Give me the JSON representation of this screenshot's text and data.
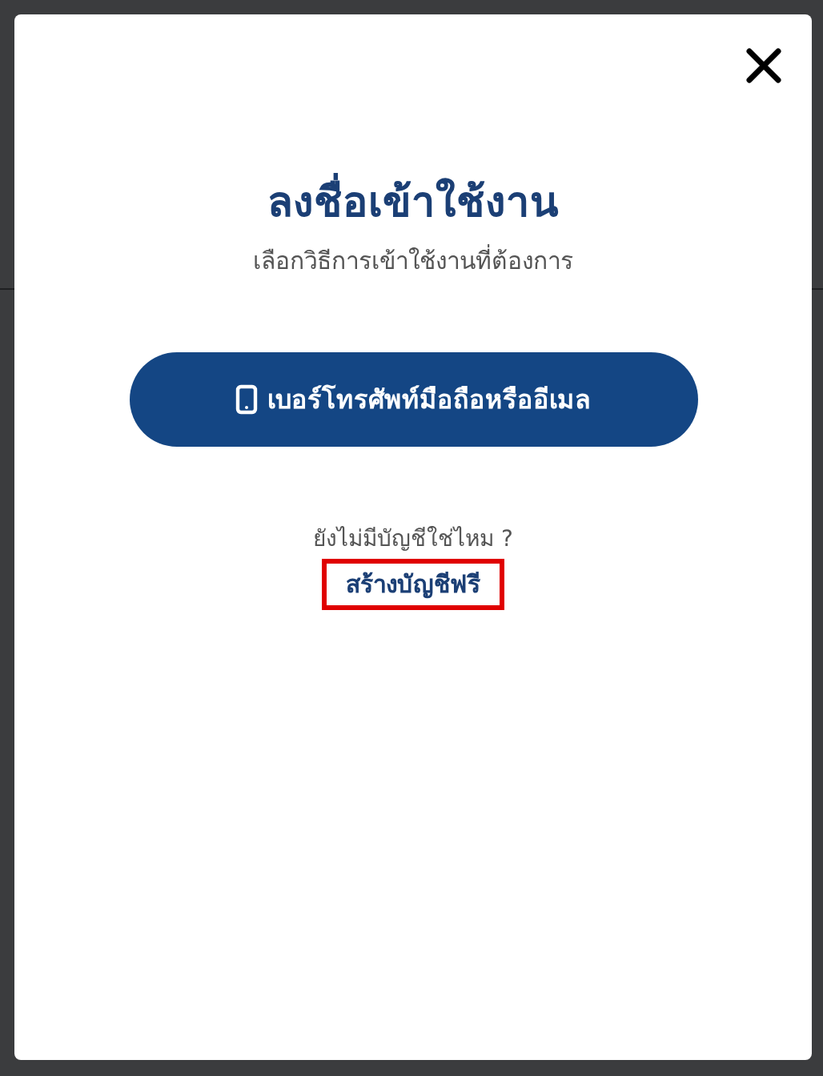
{
  "dialog": {
    "title": "ลงชื่อเข้าใช้งาน",
    "subtitle": "เลือกวิธีการเข้าใช้งานที่ต้องการ",
    "login_button": "เบอร์โทรศัพท์มือถือหรืออีเมล",
    "signup_prompt": "ยังไม่มีบัญชีใช่ไหม ?",
    "signup_link": {
      "label": "สร้างบัญชีฟรี",
      "highlighted": true
    }
  }
}
